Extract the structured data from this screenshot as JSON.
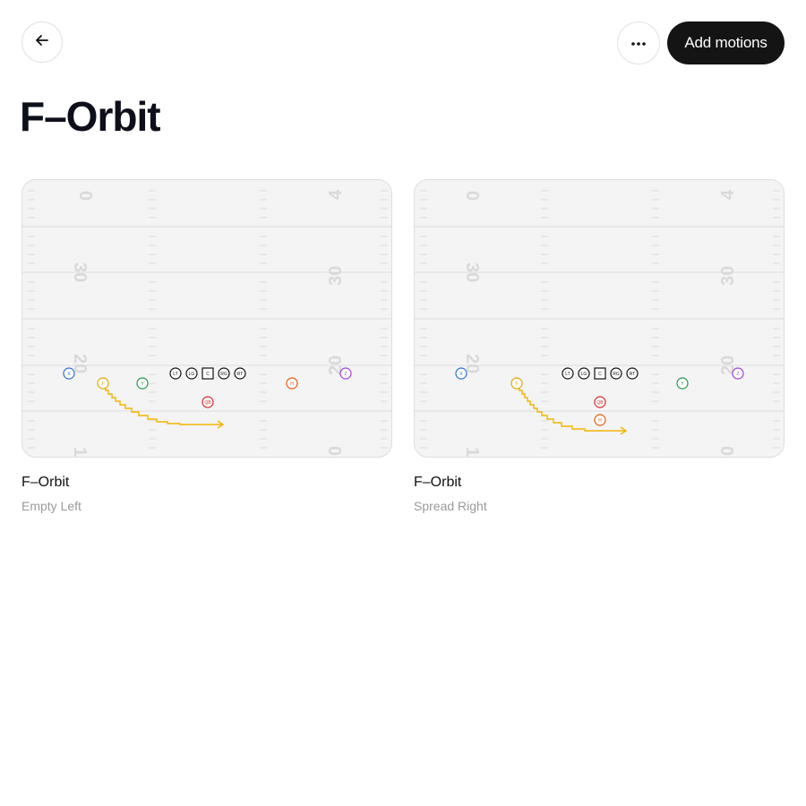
{
  "header": {
    "back_icon": "arrow-left-icon",
    "more_icon": "ellipsis-icon",
    "add_motions_label": "Add motions"
  },
  "page_title": "F–Orbit",
  "colors": {
    "accent_dark": "#141414",
    "x_player": "#2b6fd6",
    "f_player": "#e0a800",
    "y_player": "#1e9a4a",
    "h_player": "#e8590c",
    "z_player": "#a23fd8",
    "qb_player": "#d42a2a",
    "motion_path": "#f2b400"
  },
  "field_yard_numbers": [
    "0",
    "4",
    "30",
    "30",
    "20",
    "20",
    "1",
    "0"
  ],
  "plays": [
    {
      "name": "F–Orbit",
      "formation": "Empty Left",
      "players": [
        "X",
        "F",
        "Y",
        "LT",
        "LG",
        "C",
        "RG",
        "RT",
        "QB",
        "H",
        "Z"
      ]
    },
    {
      "name": "F–Orbit",
      "formation": "Spread Right",
      "players": [
        "X",
        "F",
        "LT",
        "LG",
        "C",
        "RG",
        "RT",
        "QB",
        "H",
        "Y",
        "Z"
      ]
    }
  ]
}
